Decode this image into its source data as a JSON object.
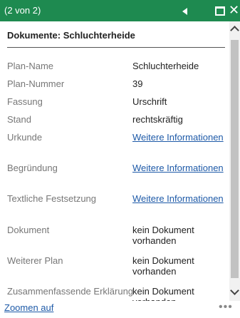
{
  "header": {
    "pager": "(2 von 2)",
    "prev_icon": "triangle-left-icon",
    "maximize_icon": "maximize-icon",
    "close_icon": "close-icon",
    "close_glyph": "✕"
  },
  "content": {
    "title": "Dokumente: Schluchterheide",
    "rows": [
      {
        "label": "Plan-Name",
        "value": "Schluchterheide"
      },
      {
        "label": "Plan-Nummer",
        "value": "39"
      },
      {
        "label": "Fassung",
        "value": "Urschrift"
      },
      {
        "label": "Stand",
        "value": "rechtskräftig"
      },
      {
        "label": "Urkunde",
        "link": "Weitere Informationen"
      },
      {
        "label": "Begründung",
        "link": "Weitere Informationen"
      },
      {
        "label": "Textliche Festsetzung",
        "link": "Weitere Informationen"
      },
      {
        "label": "Dokument",
        "value": "kein Dokument vorhanden"
      },
      {
        "label": "Weiterer Plan",
        "value": "kein Dokument vorhanden"
      },
      {
        "label": "Zusammenfassende Erklärung",
        "value": "kein Dokument vorhanden"
      }
    ]
  },
  "footer": {
    "zoom_link": "Zoomen auf",
    "more_glyph": "•••"
  },
  "colors": {
    "header_bg": "#1e8a50",
    "link": "#1e5aa8"
  }
}
